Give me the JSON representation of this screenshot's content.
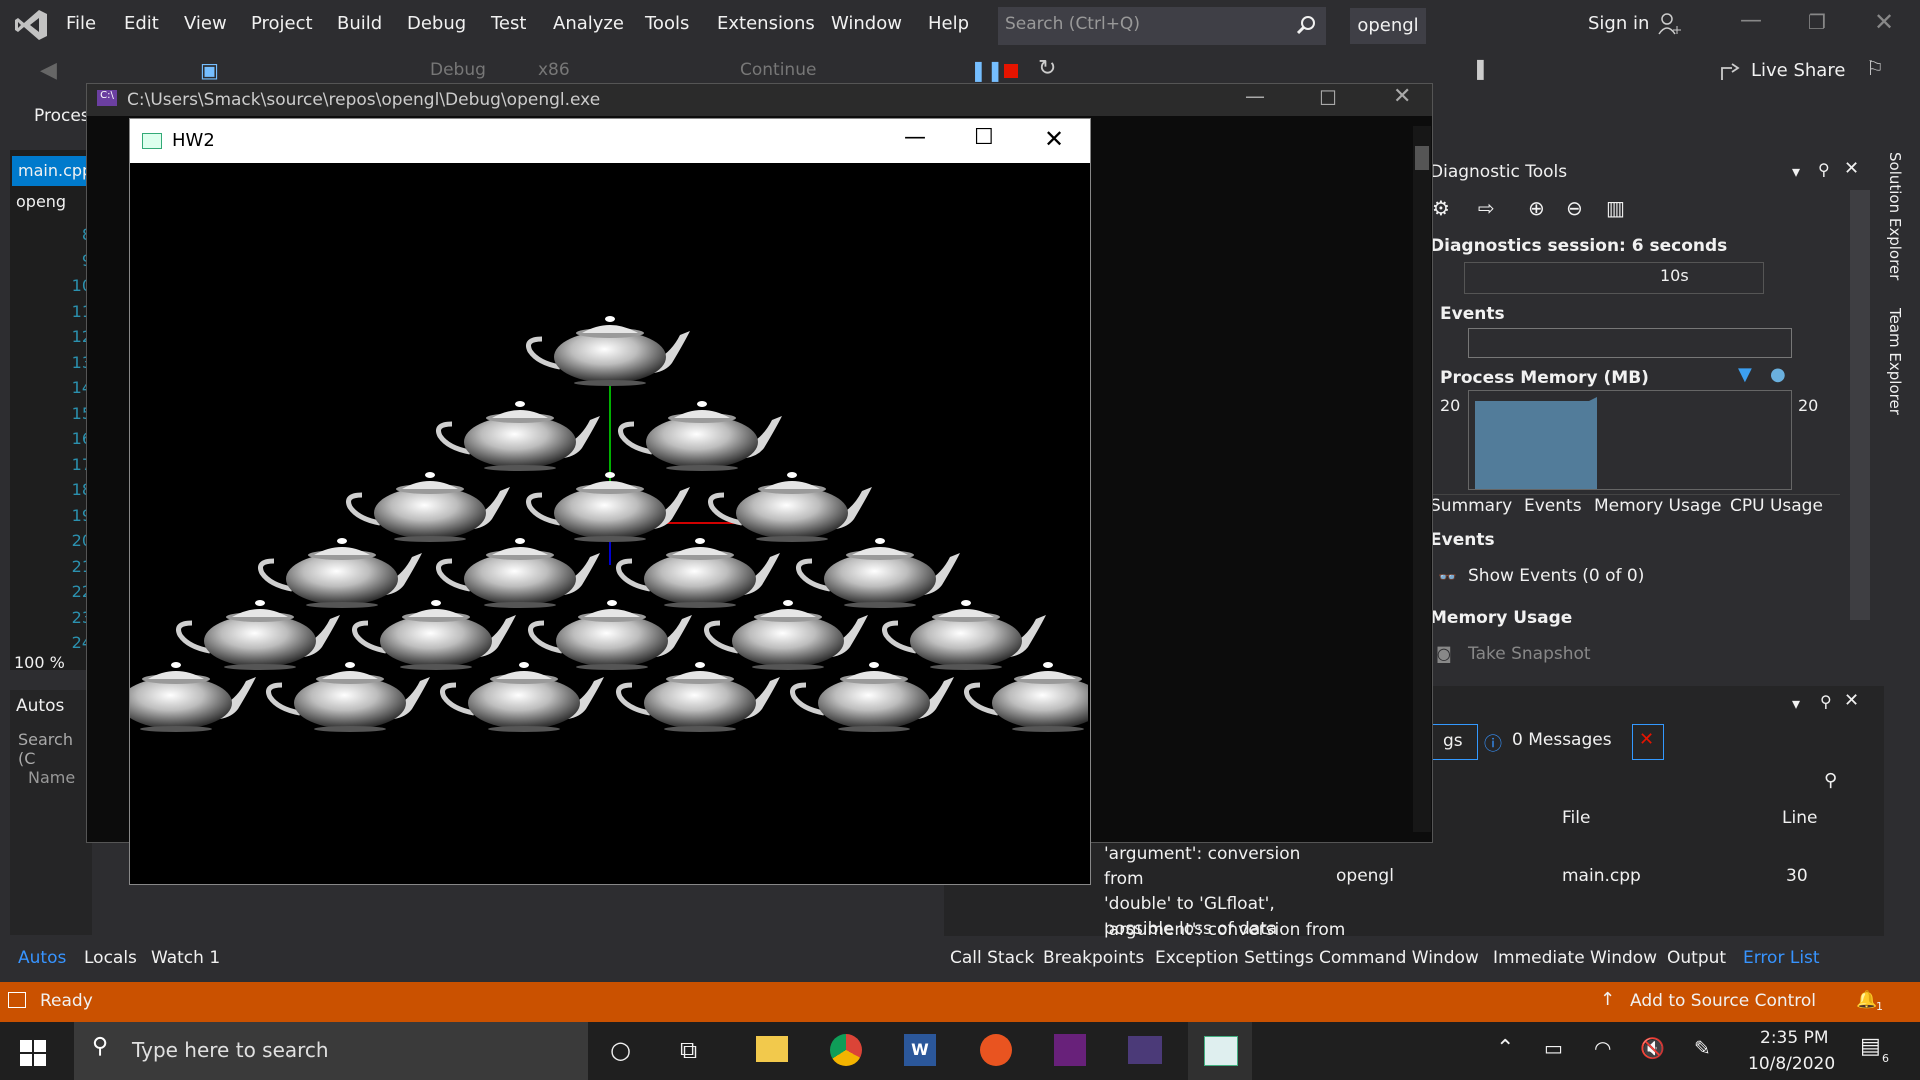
{
  "menu": [
    "File",
    "Edit",
    "View",
    "Project",
    "Build",
    "Debug",
    "Test",
    "Analyze",
    "Tools",
    "Extensions",
    "Window",
    "Help"
  ],
  "search": {
    "placeholder": "Search (Ctrl+Q)"
  },
  "project_name": "opengl",
  "sign_in": "Sign in",
  "live_share": "Live Share",
  "toolbar": {
    "config": "Debug",
    "platform": "x86",
    "continue": "Continue"
  },
  "left": {
    "process_label": "Proces",
    "tab": "main.cpp",
    "project": "openg",
    "line_numbers": [
      "8",
      "9",
      "10",
      "11",
      "12",
      "13",
      "14",
      "15",
      "16",
      "17",
      "18",
      "19",
      "20",
      "21",
      "22",
      "23",
      "24"
    ],
    "zoom": "100 %",
    "autos": "Autos",
    "search": "Search (C",
    "name_col": "Name"
  },
  "console": {
    "title": "C:\\Users\\Smack\\source\\repos\\opengl\\Debug\\opengl.exe"
  },
  "hw2": {
    "title": "HW2"
  },
  "diagnostics": {
    "title": "Diagnostic Tools",
    "session": "Diagnostics session: 6 seconds",
    "timeline_tick": "10s",
    "events": "Events",
    "process_memory": "Process Memory (MB)",
    "mem_left": "20",
    "mem_right": "20",
    "tabs": [
      "Summary",
      "Events",
      "Memory Usage",
      "CPU Usage"
    ],
    "events_header": "Events",
    "show_events": "Show Events (0 of 0)",
    "memory_usage": "Memory Usage",
    "take_snapshot": "Take Snapshot"
  },
  "errors": {
    "filter_partial": "gs",
    "messages": "0 Messages",
    "col_file": "File",
    "col_line": "Line",
    "row1_desc": [
      "'argument': conversion from",
      "'double' to 'GLfloat',",
      "possible loss of data"
    ],
    "row1_project": "opengl",
    "row1_file": "main.cpp",
    "row1_line": "30",
    "row2_desc": "'argument': conversion from"
  },
  "bottom_tabs_left": [
    "Autos",
    "Locals",
    "Watch 1"
  ],
  "bottom_tabs_right": [
    "Call Stack",
    "Breakpoints",
    "Exception Settings",
    "Command Window",
    "Immediate Window",
    "Output",
    "Error List"
  ],
  "status": {
    "ready": "Ready",
    "source_control": "Add to Source Control",
    "notifications": "1"
  },
  "taskbar": {
    "search": "Type here to search",
    "time": "2:35 PM",
    "date": "10/8/2020",
    "notif_count": "6"
  },
  "side_tabs": [
    "Solution Explorer",
    "Team Explorer"
  ]
}
